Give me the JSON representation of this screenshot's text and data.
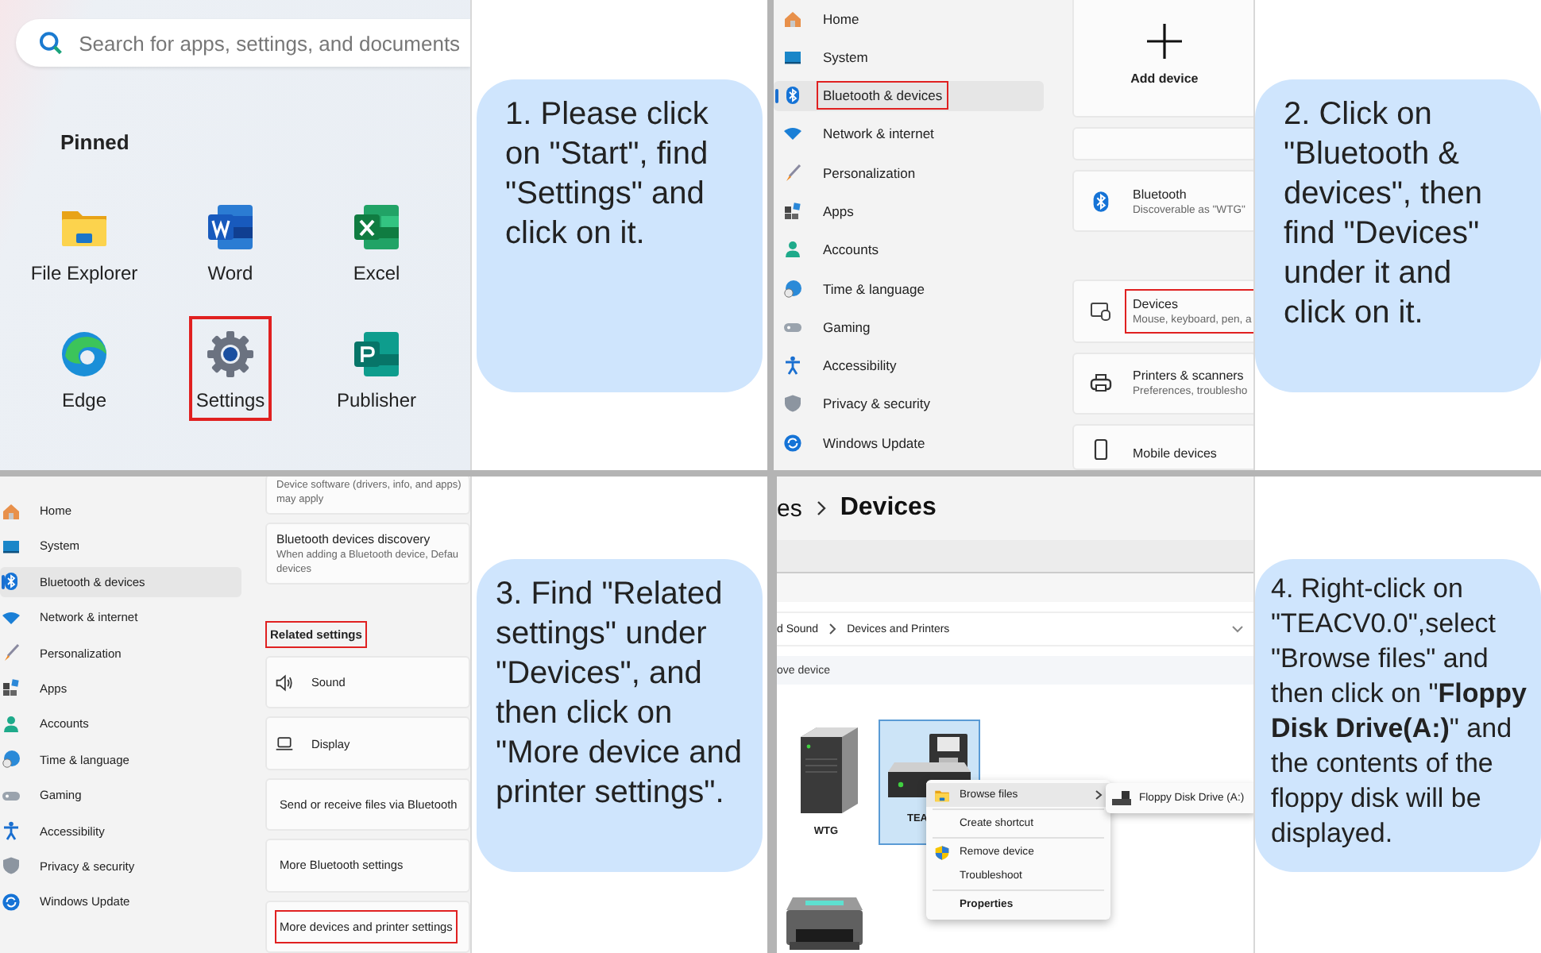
{
  "step1": {
    "search": {
      "placeholder": "Search for apps, settings, and documents"
    },
    "section_title": "Pinned",
    "apps": [
      {
        "label": "File Explorer",
        "highlighted": false
      },
      {
        "label": "Word",
        "highlighted": false
      },
      {
        "label": "Excel",
        "highlighted": false
      },
      {
        "label": "Edge",
        "highlighted": false
      },
      {
        "label": "Settings",
        "highlighted": true
      },
      {
        "label": "Publisher",
        "highlighted": false
      }
    ],
    "instruction": "1. Please click on \"Start\", find \"Settings\" and click on it."
  },
  "step2": {
    "sidebar": [
      {
        "label": "Home",
        "selected": false,
        "highlighted": false
      },
      {
        "label": "System",
        "selected": false,
        "highlighted": false
      },
      {
        "label": "Bluetooth & devices",
        "selected": true,
        "highlighted": true
      },
      {
        "label": "Network & internet",
        "selected": false,
        "highlighted": false
      },
      {
        "label": "Personalization",
        "selected": false,
        "highlighted": false
      },
      {
        "label": "Apps",
        "selected": false,
        "highlighted": false
      },
      {
        "label": "Accounts",
        "selected": false,
        "highlighted": false
      },
      {
        "label": "Time & language",
        "selected": false,
        "highlighted": false
      },
      {
        "label": "Gaming",
        "selected": false,
        "highlighted": false
      },
      {
        "label": "Accessibility",
        "selected": false,
        "highlighted": false
      },
      {
        "label": "Privacy & security",
        "selected": false,
        "highlighted": false
      },
      {
        "label": "Windows Update",
        "selected": false,
        "highlighted": false
      }
    ],
    "cards": [
      {
        "kind": "add",
        "title": "Add device"
      },
      {
        "kind": "blank"
      },
      {
        "kind": "row",
        "title": "Bluetooth",
        "subtitle": "Discoverable as \"WTG\"",
        "highlighted": false
      },
      {
        "kind": "row",
        "title": "Devices",
        "subtitle": "Mouse, keyboard, pen, a",
        "highlighted": true
      },
      {
        "kind": "row",
        "title": "Printers & scanners",
        "subtitle": "Preferences, troublesho",
        "highlighted": false
      },
      {
        "kind": "row",
        "title": "Mobile devices",
        "highlighted": false
      }
    ],
    "instruction": "2. Click on \"Bluetooth & devices\", then find \"Devices\" under it and click on it."
  },
  "step3": {
    "sidebar": [
      {
        "label": "Home",
        "selected": false
      },
      {
        "label": "System",
        "selected": false
      },
      {
        "label": "Bluetooth & devices",
        "selected": true
      },
      {
        "label": "Network & internet",
        "selected": false
      },
      {
        "label": "Personalization",
        "selected": false
      },
      {
        "label": "Apps",
        "selected": false
      },
      {
        "label": "Accounts",
        "selected": false
      },
      {
        "label": "Time & language",
        "selected": false
      },
      {
        "label": "Gaming",
        "selected": false
      },
      {
        "label": "Accessibility",
        "selected": false
      },
      {
        "label": "Privacy & security",
        "selected": false
      },
      {
        "label": "Windows Update",
        "selected": false
      }
    ],
    "info_cards": [
      {
        "description_lines": [
          "Device software (drivers, info, and apps)",
          "may apply"
        ]
      },
      {
        "title": "Bluetooth devices discovery",
        "description_lines": [
          "When adding a Bluetooth device, Defau",
          "devices"
        ]
      }
    ],
    "section_title": {
      "label": "Related settings",
      "highlighted": true
    },
    "links": [
      {
        "label": "Sound",
        "highlighted": false
      },
      {
        "label": "Display",
        "highlighted": false
      },
      {
        "label": "Send or receive files via Bluetooth",
        "highlighted": false
      },
      {
        "label": "More Bluetooth settings",
        "highlighted": false
      },
      {
        "label": "More devices and printer settings",
        "highlighted": true
      }
    ],
    "instruction": "3. Find \"Related settings\" under \"Devices\", and then click on \"More device and printer settings\"."
  },
  "step4": {
    "breadcrumb": [
      "es",
      "Devices"
    ],
    "address": [
      "d Sound",
      "Devices and Printers"
    ],
    "toolbar_action": "ove device",
    "devices": [
      {
        "label": "WTG",
        "selected": false
      },
      {
        "label": "TEA",
        "selected": true
      }
    ],
    "context_menu": [
      {
        "label": "Browse files",
        "kind": "submenu",
        "selected": true,
        "separator_after": true
      },
      {
        "label": "Create shortcut",
        "kind": "plain",
        "selected": false,
        "separator_after": true
      },
      {
        "label": "Remove device",
        "kind": "plain",
        "selected": false,
        "separator_after": false
      },
      {
        "label": "Troubleshoot",
        "kind": "plain",
        "selected": false,
        "separator_after": true
      },
      {
        "label": "Properties",
        "kind": "default",
        "selected": false,
        "separator_after": false
      }
    ],
    "submenu": {
      "label": "Floppy Disk Drive (A:)"
    },
    "instruction": "4. Right-click on \"TEACV0.0\",select \"Browse files\" and then click on \"**Floppy Disk Drive(A:)**\" and the contents of the floppy disk will be displayed."
  }
}
